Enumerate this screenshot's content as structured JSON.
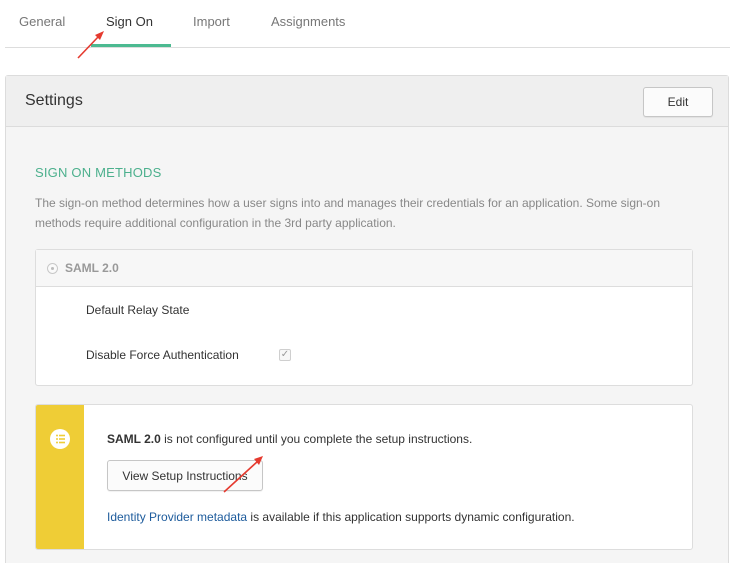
{
  "tabs": [
    {
      "label": "General"
    },
    {
      "label": "Sign On"
    },
    {
      "label": "Import"
    },
    {
      "label": "Assignments"
    }
  ],
  "settings": {
    "title": "Settings",
    "edit_label": "Edit"
  },
  "sign_on": {
    "section_title": "SIGN ON METHODS",
    "description": "The sign-on method determines how a user signs into and manages their credentials for an application. Some sign-on methods require additional configuration in the 3rd party application.",
    "method_label": "SAML 2.0",
    "fields": {
      "default_relay_state": "Default Relay State",
      "disable_force_auth": "Disable Force Authentication"
    }
  },
  "notice": {
    "strong": "SAML 2.0",
    "message": " is not configured until you complete the setup instructions.",
    "button_label": "View Setup Instructions",
    "link_text": "Identity Provider metadata",
    "link_suffix": " is available if this application supports dynamic configuration."
  },
  "colors": {
    "accent_green": "#4cba91",
    "notice_yellow": "#efcd36",
    "link_blue": "#1d5b9c",
    "annotation_red": "#e53a2f"
  }
}
